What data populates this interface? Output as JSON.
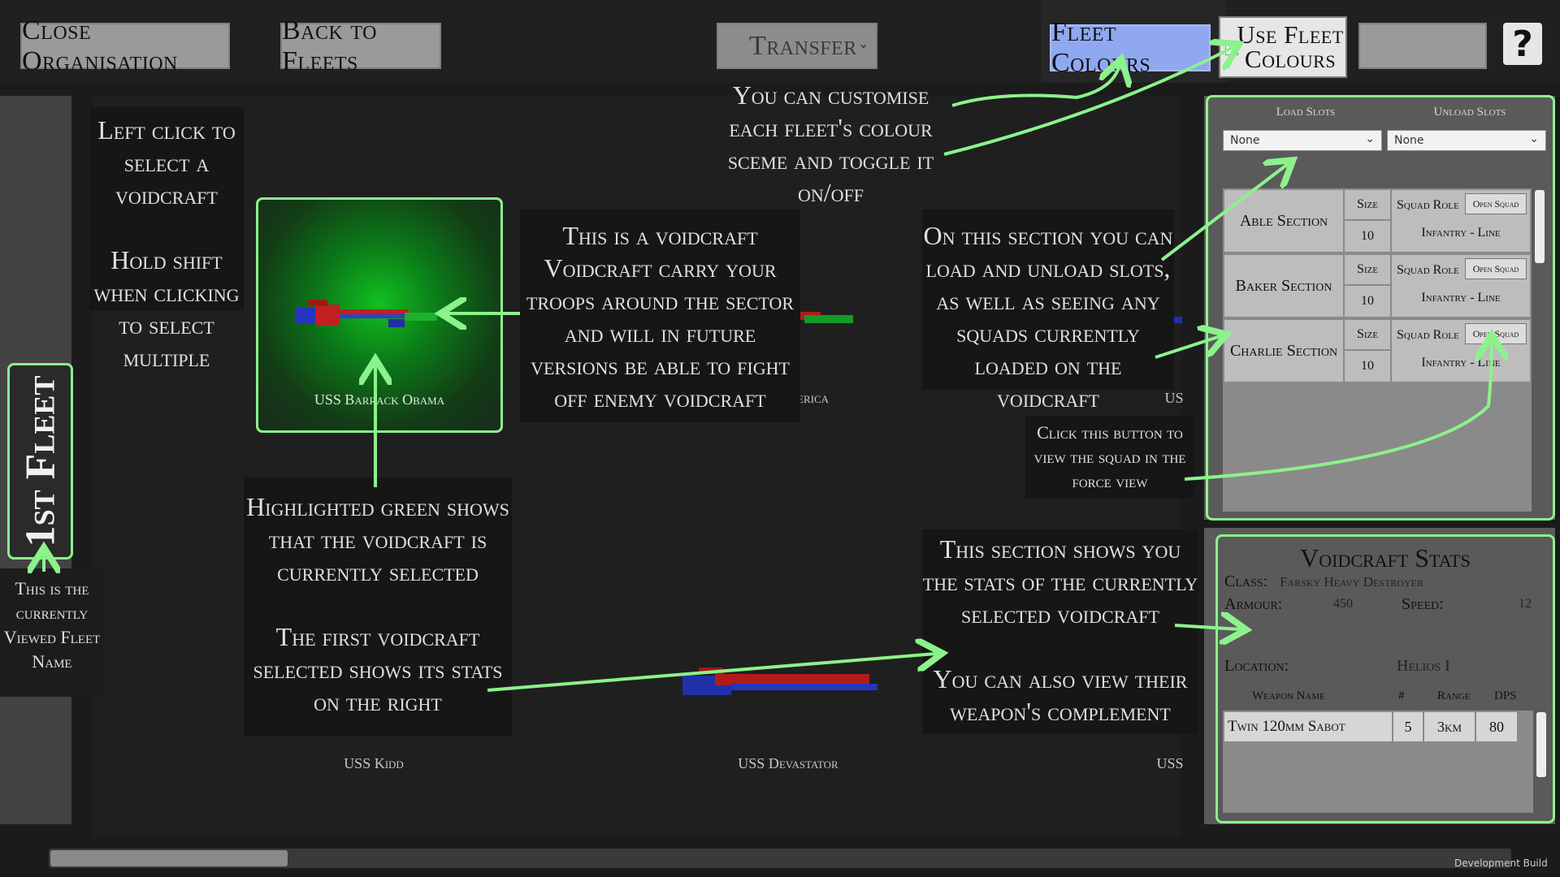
{
  "toolbar": {
    "close_label": "Close Organisation",
    "back_label": "Back to Fleets",
    "transfer_label": "Transfer",
    "fleet_colours_label": "Fleet Colours",
    "use_fleet_colours_label": "Use Fleet Colours",
    "help_label": "?"
  },
  "fleet": {
    "name": "1st Fleet"
  },
  "ships": [
    {
      "name": "USS Barrack Obama"
    },
    {
      "name": "USS America"
    },
    {
      "name": "US"
    },
    {
      "name": "USS Kidd"
    },
    {
      "name": "USS Devastator"
    },
    {
      "name": "USS"
    }
  ],
  "annotations": {
    "left_click": "Left click to select a voidcraft",
    "hold_shift": "Hold shift when clicking to select multiple",
    "voidcraft_info": "This is a voidcraft Voidcraft carry your troops around the sector and will in future versions be able to fight off enemy voidcraft",
    "customise_colours": "You can customise each fleet's colour sceme and toggle it on/off",
    "load_section": "On this section you can load and unload slots, as well as seeing any squads currently loaded on the voidcraft",
    "open_squad_tip": "Click this button to view the squad in the force view",
    "highlight_green": "Highlighted green shows that the voidcraft is currently selected",
    "first_selected": "The first voidcraft selected shows its stats on the right",
    "stats_section": "This section shows you the stats of the currently selected voidcraft",
    "weapons_info": "You can also view their weapon's complement",
    "fleet_name_tip": "This is the currently Viewed Fleet Name"
  },
  "slots": {
    "load_label": "Load Slots",
    "unload_label": "Unload Slots",
    "load_value": "None",
    "unload_value": "None",
    "size_label": "Size",
    "role_label": "Squad Role",
    "open_label": "Open Squad",
    "sections": [
      {
        "name": "Able Section",
        "size": "10",
        "role": "Infantry - Line"
      },
      {
        "name": "Baker Section",
        "size": "10",
        "role": "Infantry - Line"
      },
      {
        "name": "Charlie Section",
        "size": "10",
        "role": "Infantry - Line"
      }
    ]
  },
  "stats": {
    "title": "Voidcraft Stats",
    "class_label": "Class:",
    "class_value": "Farsky Heavy Destroyer",
    "armour_label": "Armour:",
    "armour_value": "450",
    "speed_label": "Speed:",
    "speed_value": "12",
    "location_label": "Location:",
    "location_value": "Helios I",
    "weapon_header": "Weapon Name",
    "count_header": "#",
    "range_header": "Range",
    "dps_header": "DPS",
    "weapons": [
      {
        "name": "Twin 120mm Sabot",
        "count": "5",
        "range": "3km",
        "dps": "80"
      }
    ]
  },
  "footer": {
    "build_label": "Development Build"
  },
  "colors": {
    "highlight_green": "#8cf28c",
    "button_blue": "#8fa8f0",
    "panel_grey": "#5a5a5a"
  }
}
